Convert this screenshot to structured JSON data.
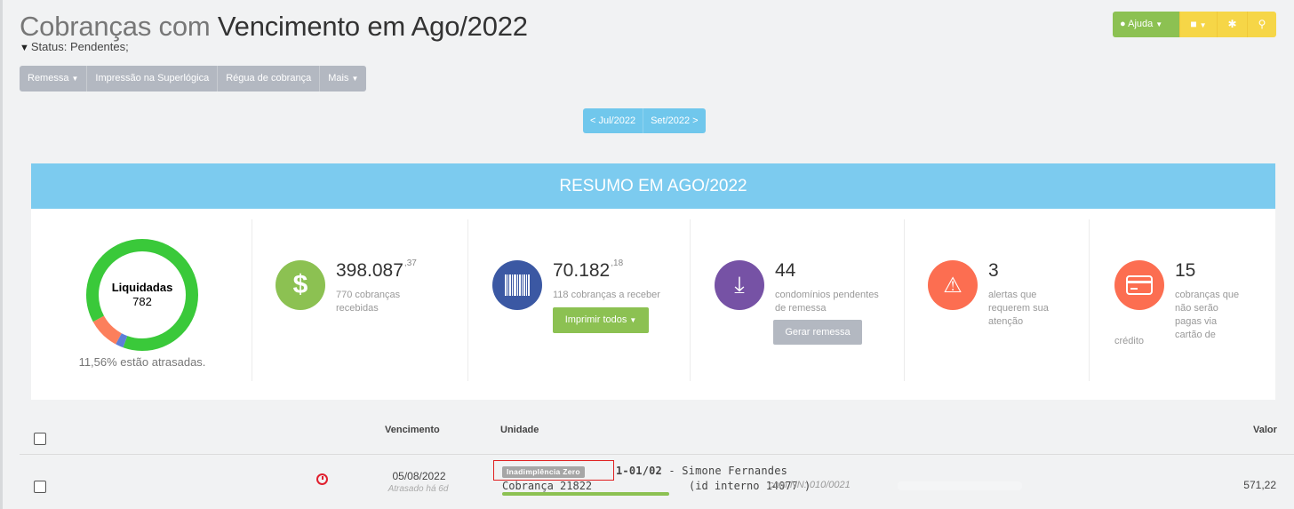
{
  "header": {
    "title_part1": "Cobranças com",
    "title_part2": " Vencimento em Ago/2022",
    "filter": "Status: Pendentes;"
  },
  "toolbar": {
    "remessa": "Remessa",
    "impressao": "Impressão na Superlógica",
    "regua": "Régua de cobrança",
    "mais": "Mais"
  },
  "top_actions": {
    "help": "Ajuda"
  },
  "pager": {
    "prev": "< Jul/2022",
    "next": "Set/2022 >"
  },
  "summary": {
    "title": "RESUMO EM AGO/2022",
    "donut": {
      "label": "Liquidadas",
      "count": "782",
      "late_text": "11,56% estão atrasadas.",
      "liquidadas_fraction": 0.885,
      "atrasadas_fraction": 0.092,
      "outros_fraction": 0.023,
      "colors": {
        "liquidadas": "#3ac93a",
        "atrasadas": "#fc7f5c",
        "outros": "#5d7fd8"
      }
    },
    "recebidas": {
      "value": "398.087",
      "cents": ",37",
      "desc": "770 cobranças recebidas",
      "color": "#8cc152"
    },
    "a_receber": {
      "value": "70.182",
      "cents": ",18",
      "desc": "118 cobranças a receber",
      "button": "Imprimir todos",
      "color": "#3b58a3"
    },
    "remessa": {
      "value": "44",
      "desc": "condomínios pendentes de remessa",
      "button": "Gerar remessa",
      "color": "#7652a5"
    },
    "alertas": {
      "value": "3",
      "desc": "alertas que requerem sua atenção",
      "color": "#fc6e51"
    },
    "cartao": {
      "value": "15",
      "desc1": "cobranças que não serão pagas via cartão de",
      "desc2": "crédito",
      "color": "#fc6e51"
    }
  },
  "table": {
    "headers": {
      "vencimento": "Vencimento",
      "unidade": "Unidade",
      "valor": "Valor"
    },
    "rows": [
      {
        "date": "05/08/2022",
        "late": "Atrasado há 6d",
        "badge": "Inadimplência Zero",
        "unit_code": "1-01/02",
        "unit_name": " - Simone Fernandes",
        "cobranca": "Cobrança 21822",
        "id_interno": "(id interno 14077 )",
        "nn": "com NN: 010/0021",
        "valor": "571,22",
        "paid_fraction": 1.0
      }
    ]
  }
}
